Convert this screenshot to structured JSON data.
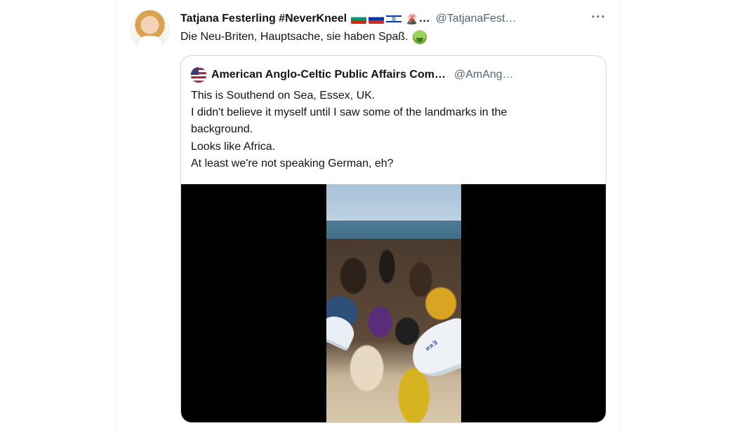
{
  "tweet": {
    "display_name": "Tatjana Festerling #NeverKneel",
    "name_suffix": "…",
    "handle": "@TatjanaFest…",
    "more_label": "···",
    "text": "Die Neu-Briten, Hauptsache, sie haben Spaß.",
    "flags": [
      "bulgaria-flag",
      "russia-flag",
      "israel-flag"
    ],
    "trailing_emoji": "volcano-icon",
    "text_emoji": "nauseated-face-icon"
  },
  "quoted_tweet": {
    "display_name": "American Anglo-Celtic Public Affairs Com…",
    "handle": "@AmAng…",
    "avatar_icon": "us-flag-avatar",
    "lines": [
      "This is Southend on Sea, Essex, UK.",
      "I didn't believe it myself until I saw some of the landmarks in the",
      "background.",
      "Looks like Africa.",
      "At least we're not speaking German, eh?"
    ],
    "media": {
      "type": "video",
      "umbrella_text": "ᴎᴙƎ"
    }
  },
  "colors": {
    "text_primary": "#0f1419",
    "text_secondary": "#536471",
    "border": "#cfd9de",
    "media_letterbox": "#000000"
  }
}
